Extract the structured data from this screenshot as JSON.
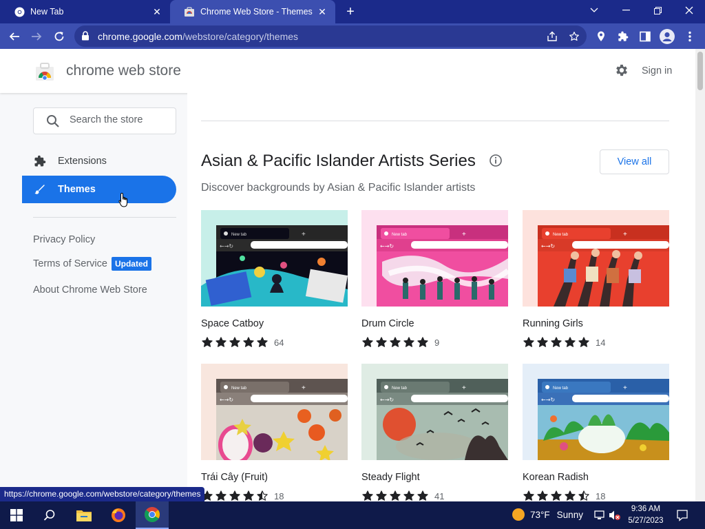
{
  "browser": {
    "tabs": [
      {
        "title": "New Tab",
        "icon": "chrome-icon",
        "active": false
      },
      {
        "title": "Chrome Web Store - Themes",
        "icon": "web-store-icon",
        "active": true
      }
    ],
    "url_host": "chrome.google.com",
    "url_path": "/webstore/category/themes",
    "status_url": "https://chrome.google.com/webstore/category/themes"
  },
  "store": {
    "title": "chrome web store",
    "sign_in": "Sign in",
    "search_placeholder": "Search the store",
    "nav": [
      {
        "label": "Extensions",
        "icon": "puzzle-icon",
        "selected": false
      },
      {
        "label": "Themes",
        "icon": "brush-icon",
        "selected": true
      }
    ],
    "links": {
      "privacy": "Privacy Policy",
      "terms": "Terms of Service",
      "terms_badge": "Updated",
      "about": "About Chrome Web Store"
    }
  },
  "section": {
    "title": "Asian & Pacific Islander Artists Series",
    "subtitle": "Discover backgrounds by Asian & Pacific Islander artists",
    "view_all": "View all"
  },
  "themes": [
    {
      "name": "Space Catboy",
      "rating": 5,
      "count": "64"
    },
    {
      "name": "Drum Circle",
      "rating": 5,
      "count": "9"
    },
    {
      "name": "Running Girls",
      "rating": 5,
      "count": "14"
    },
    {
      "name": "Trái Cây (Fruit)",
      "rating": 4.5,
      "count": "18"
    },
    {
      "name": "Steady Flight",
      "rating": 5,
      "count": "41"
    },
    {
      "name": "Korean Radish",
      "rating": 4.5,
      "count": "18"
    }
  ],
  "thumb_text": "New tab",
  "taskbar": {
    "temperature": "73°F",
    "condition": "Sunny",
    "time": "9:36 AM",
    "date": "5/27/2023"
  },
  "colors": {
    "frame": "#1b2a8a",
    "toolbar": "#3c4fb0",
    "accent": "#1a73e8",
    "star": "#202124"
  }
}
